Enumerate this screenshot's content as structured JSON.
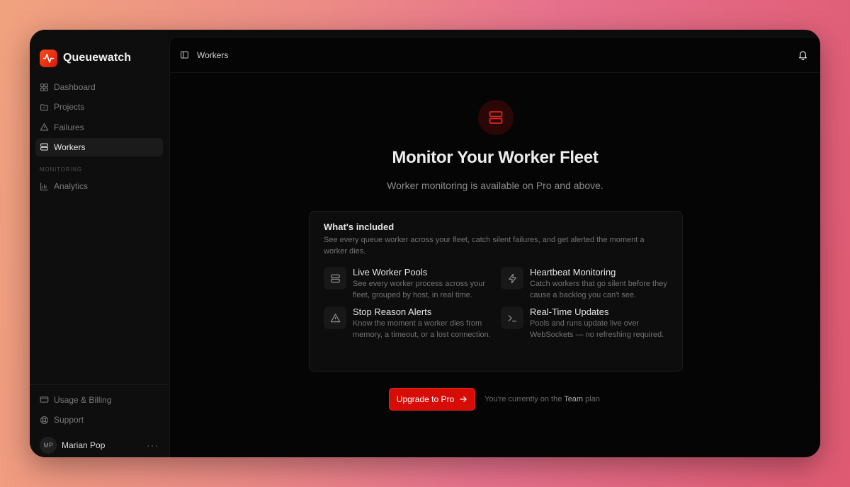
{
  "app": {
    "name": "Queuewatch"
  },
  "sidebar": {
    "items": [
      {
        "label": "Dashboard",
        "icon": "grid-icon"
      },
      {
        "label": "Projects",
        "icon": "folder-icon"
      },
      {
        "label": "Failures",
        "icon": "warning-icon"
      },
      {
        "label": "Workers",
        "icon": "server-icon",
        "active": true
      }
    ],
    "section_label": "MONITORING",
    "section_items": [
      {
        "label": "Analytics",
        "icon": "bar-chart-icon"
      }
    ],
    "bottom_items": [
      {
        "label": "Usage & Billing",
        "icon": "credit-card-icon"
      },
      {
        "label": "Support",
        "icon": "lifebuoy-icon"
      }
    ],
    "user": {
      "initials": "MP",
      "name": "Marian Pop",
      "more": "···"
    }
  },
  "topbar": {
    "title": "Workers"
  },
  "hero": {
    "title": "Monitor Your Worker Fleet",
    "subtitle": "Worker monitoring is available on Pro and above."
  },
  "card": {
    "title": "What's included",
    "description": "See every queue worker across your fleet, catch silent failures, and get alerted the moment a worker dies.",
    "features": [
      {
        "title": "Live Worker Pools",
        "description": "See every worker process across your fleet, grouped by host, in real time.",
        "icon": "server-icon"
      },
      {
        "title": "Heartbeat Monitoring",
        "description": "Catch workers that go silent before they cause a backlog you can't see.",
        "icon": "lightning-icon"
      },
      {
        "title": "Stop Reason Alerts",
        "description": "Know the moment a worker dies from memory, a timeout, or a lost connection.",
        "icon": "warning-icon"
      },
      {
        "title": "Real-Time Updates",
        "description": "Pools and runs update live over WebSockets — no refreshing required.",
        "icon": "terminal-icon"
      }
    ]
  },
  "cta": {
    "button_label": "Upgrade to Pro",
    "plan_prefix": "You're currently on the",
    "plan_name": "Team",
    "plan_suffix": "plan"
  },
  "colors": {
    "accent": "#d60c07",
    "background": "#050505",
    "sidebar": "#0e0e0e"
  }
}
